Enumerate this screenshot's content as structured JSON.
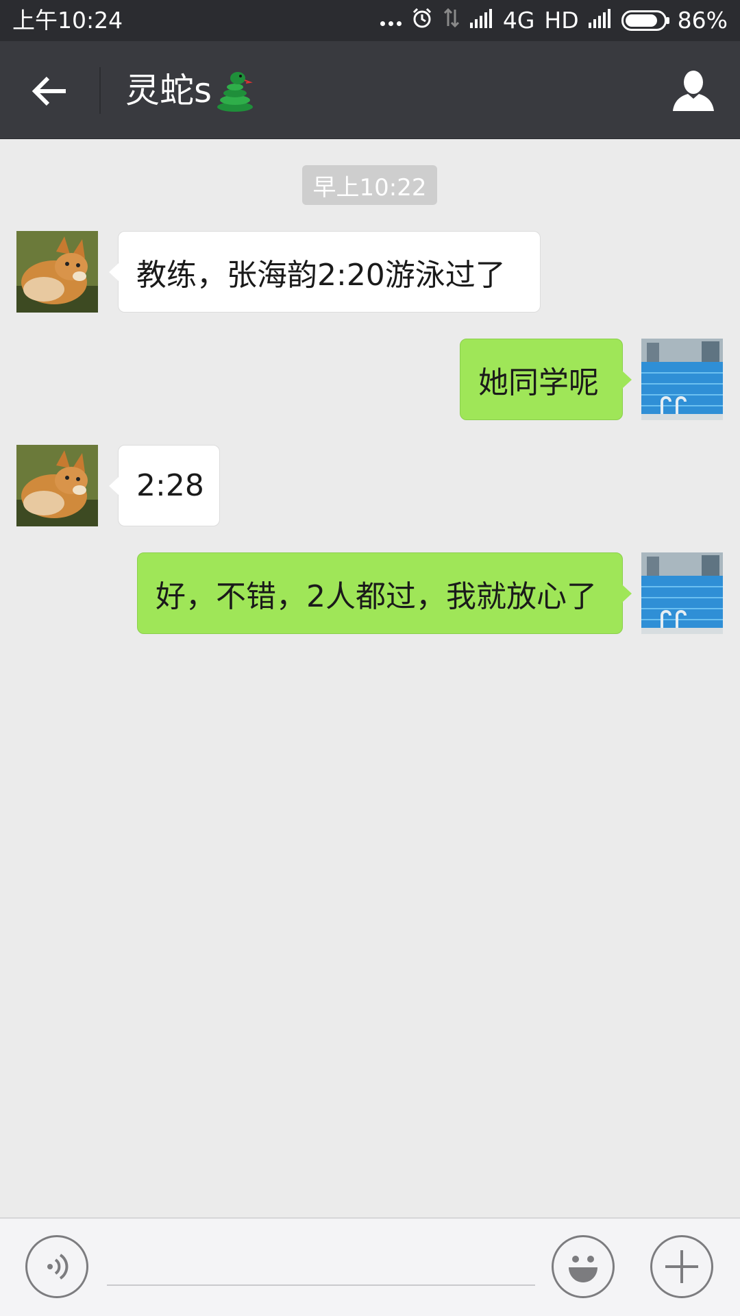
{
  "status_bar": {
    "time": "上午10:24",
    "network": "4G",
    "hd": "HD",
    "battery_percent": "86%",
    "battery_level": 0.86
  },
  "header": {
    "title": "灵蛇s",
    "title_emoji": "snake-emoji"
  },
  "chat": {
    "timestamp": "早上10:22",
    "messages": [
      {
        "direction": "incoming",
        "text": "教练，张海韵2:20游泳过了",
        "avatar": "fox-avatar"
      },
      {
        "direction": "outgoing",
        "text": "她同学呢",
        "avatar": "pool-avatar"
      },
      {
        "direction": "incoming",
        "text": "2:28",
        "avatar": "fox-avatar"
      },
      {
        "direction": "outgoing",
        "text": "好，不错，2人都过，我就放心了",
        "avatar": "pool-avatar"
      }
    ]
  },
  "input_bar": {
    "placeholder": "",
    "value": ""
  },
  "colors": {
    "status_bar_bg": "#2b2c30",
    "title_bar_bg": "#393a3f",
    "chat_bg": "#ebebeb",
    "outgoing_bubble": "#9fe658",
    "incoming_bubble": "#ffffff",
    "timestamp_bg": "#cecece"
  }
}
